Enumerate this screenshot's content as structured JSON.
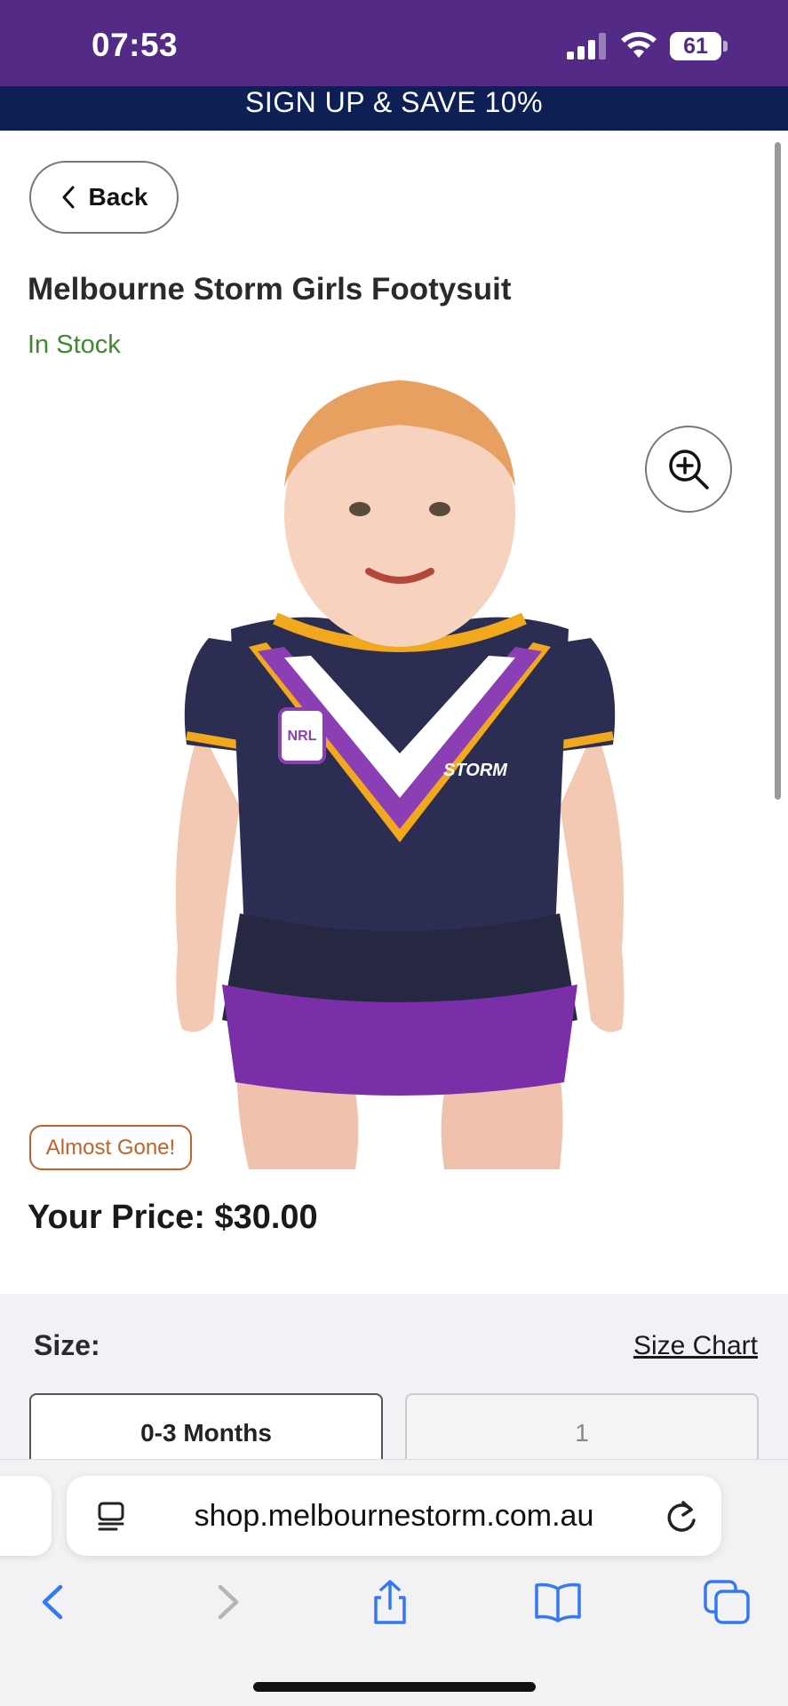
{
  "status_bar": {
    "time": "07:53",
    "battery": "61"
  },
  "promo": {
    "text": "SIGN UP & SAVE 10%"
  },
  "back_button": {
    "label": "Back"
  },
  "product": {
    "title": "Melbourne Storm Girls Footysuit",
    "stock": "In Stock",
    "badge": "Almost Gone!",
    "price_label": "Your Price: $30.00"
  },
  "size": {
    "label": "Size:",
    "chart_link": "Size Chart",
    "options": [
      "0-3 Months",
      "1"
    ]
  },
  "browser": {
    "url": "shop.melbournestorm.com.au"
  },
  "colors": {
    "status_bar": "#532b87",
    "promo_banner": "#0d1f55",
    "in_stock": "#3e8a2e",
    "badge": "#c4602a",
    "ios_blue": "#3478f6"
  },
  "icons": {
    "back": "chevron-left-icon",
    "zoom": "zoom-in-icon",
    "reader": "reader-mode-icon",
    "reload": "reload-icon",
    "nav": [
      "back-arrow-icon",
      "forward-arrow-icon",
      "share-icon",
      "bookmarks-icon",
      "tabs-icon"
    ]
  }
}
